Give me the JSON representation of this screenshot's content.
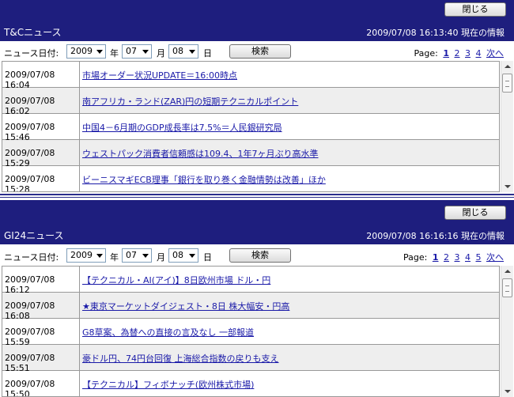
{
  "panels": [
    {
      "close_label": "閉じる",
      "title": "T&Cニュース",
      "time_info": "2009/07/08 16:13:40 現在の情報",
      "filter": {
        "label": "ニュース日付:",
        "year": "2009",
        "year_unit": "年",
        "month": "07",
        "month_unit": "月",
        "day": "08",
        "day_unit": "日",
        "search_label": "検索"
      },
      "pager": {
        "label": "Page:",
        "pages": [
          "1",
          "2",
          "3",
          "4"
        ],
        "current": "1",
        "next_label": "次へ"
      },
      "news": [
        {
          "date": "2009/07/08 16:04",
          "headline": "市場オーダー状況UPDATE＝16:00時点"
        },
        {
          "date": "2009/07/08 16:02",
          "headline": "南アフリカ・ランド(ZAR)円の短期テクニカルポイント"
        },
        {
          "date": "2009/07/08 15:46",
          "headline": "中国4－6月期のGDP成長率は7.5%＝人民銀研究局"
        },
        {
          "date": "2009/07/08 15:29",
          "headline": "ウェストパック消費者信頼感は109.4、1年7ヶ月ぶり高水準"
        },
        {
          "date": "2009/07/08 15:28",
          "headline": "ビーニスマギECB理事「銀行を取り巻く金融情勢は改善」ほか"
        }
      ]
    },
    {
      "close_label": "閉じる",
      "title": "GI24ニュース",
      "time_info": "2009/07/08 16:16:16 現在の情報",
      "filter": {
        "label": "ニュース日付:",
        "year": "2009",
        "year_unit": "年",
        "month": "07",
        "month_unit": "月",
        "day": "08",
        "day_unit": "日",
        "search_label": "検索"
      },
      "pager": {
        "label": "Page:",
        "pages": [
          "1",
          "2",
          "3",
          "4",
          "5"
        ],
        "current": "1",
        "next_label": "次へ"
      },
      "news": [
        {
          "date": "2009/07/08 16:12",
          "headline": "【テクニカル・AI(アイ)】8日欧州市場 ドル・円"
        },
        {
          "date": "2009/07/08 16:08",
          "headline": "★東京マーケットダイジェスト・8日 株大幅安・円高"
        },
        {
          "date": "2009/07/08 15:59",
          "headline": "G8草案、為替への直接の言及なし 一部報道"
        },
        {
          "date": "2009/07/08 15:51",
          "headline": "豪ドル円、74円台回復 上海総合指数の戻りも支え"
        },
        {
          "date": "2009/07/08 15:50",
          "headline": "【テクニカル】フィボナッチ(欧州株式市場)"
        }
      ]
    }
  ],
  "colors": {
    "header_bg": "#1e1e7e",
    "link": "#1a1aa8",
    "alt_row": "#eeeeee"
  }
}
